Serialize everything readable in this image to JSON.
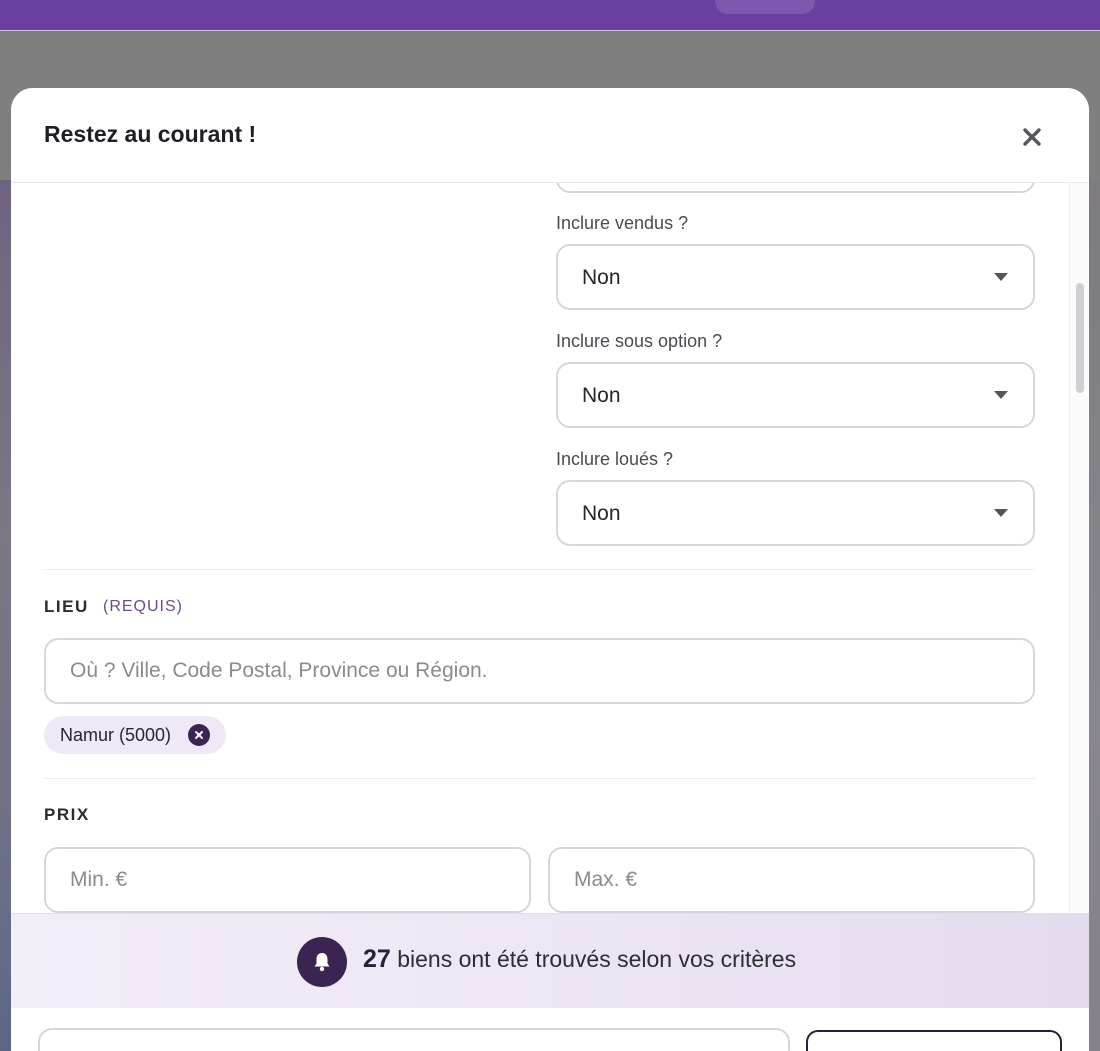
{
  "modal": {
    "title": "Restez au courant !"
  },
  "filters": {
    "sold": {
      "label": "Inclure vendus ?",
      "value": "Non"
    },
    "under_option": {
      "label": "Inclure sous option ?",
      "value": "Non"
    },
    "rented": {
      "label": "Inclure loués ?",
      "value": "Non"
    }
  },
  "location": {
    "title": "LIEU",
    "tag": "(REQUIS)",
    "placeholder": "Où ? Ville, Code Postal, Province ou Région.",
    "chips": [
      "Namur (5000)"
    ]
  },
  "price": {
    "title": "PRIX",
    "min_placeholder": "Min. €",
    "max_placeholder": "Max. €"
  },
  "results": {
    "count": "27",
    "text": "biens ont été trouvés selon vos critères"
  },
  "colors": {
    "brand": "#6b3fa0",
    "accent_dark": "#3b2352"
  },
  "icons": {
    "close": "close-icon",
    "caret": "chevron-down-icon",
    "bell": "bell-icon",
    "chip_remove": "close-circle-icon"
  }
}
